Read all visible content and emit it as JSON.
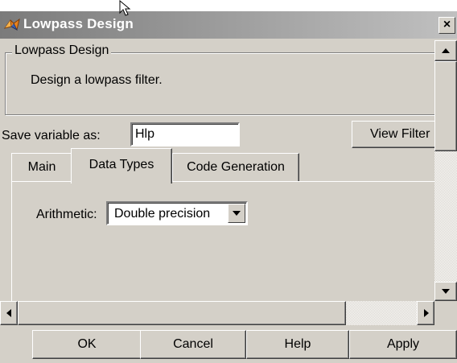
{
  "window": {
    "title": "Lowpass Design",
    "close_glyph": "×",
    "title_icon": "matlab-membrane-icon"
  },
  "group": {
    "legend": "Lowpass Design",
    "description": "Design a lowpass filter."
  },
  "save_variable": {
    "label": "Save variable as:",
    "value": "Hlp"
  },
  "view_button_label": "View Filter",
  "tabs": [
    {
      "label": "Main",
      "selected": false
    },
    {
      "label": "Data Types",
      "selected": true
    },
    {
      "label": "Code Generation",
      "selected": false
    }
  ],
  "arithmetic": {
    "label": "Arithmetic:",
    "selected": "Double precision"
  },
  "buttons": {
    "ok": "OK",
    "cancel": "Cancel",
    "help": "Help",
    "apply": "Apply"
  },
  "colors": {
    "face": "#d4d0c8",
    "title_bar": "#808080",
    "icon_orange": "#e8821e"
  }
}
